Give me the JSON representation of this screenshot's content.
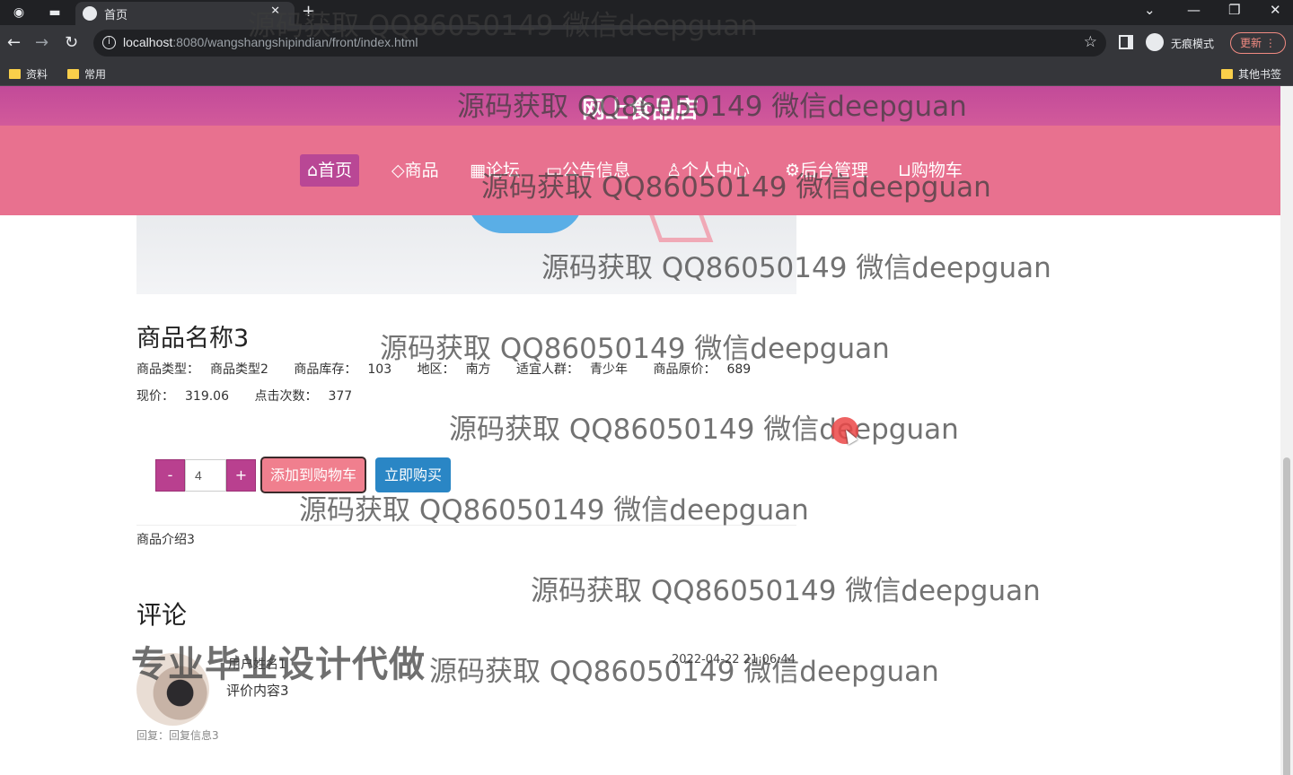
{
  "browser": {
    "tab_title": "首页",
    "url_host": "localhost",
    "url_path": ":8080/wangshangshipindian/front/index.html",
    "incognito_label": "无痕模式",
    "update_label": "更新",
    "bookmarks": [
      "资料",
      "常用"
    ],
    "other_bookmarks": "其他书签"
  },
  "site": {
    "title": "网上食品店",
    "nav": [
      {
        "icon": "⌂",
        "label": "首页"
      },
      {
        "icon": "◇",
        "label": "商品"
      },
      {
        "icon": "▦",
        "label": "论坛"
      },
      {
        "icon": "▭",
        "label": "公告信息"
      },
      {
        "icon": "♙",
        "label": "个人中心"
      },
      {
        "icon": "⚙",
        "label": "后台管理"
      },
      {
        "icon": "⊔",
        "label": "购物车"
      }
    ]
  },
  "product": {
    "name": "商品名称3",
    "type_label": "商品类型：",
    "type_value": "商品类型2",
    "stock_label": "商品库存：",
    "stock_value": "103",
    "region_label": "地区：",
    "region_value": "南方",
    "audience_label": "适宜人群：",
    "audience_value": "青少年",
    "orig_price_label": "商品原价：",
    "orig_price_value": "689",
    "price_label": "现价：",
    "price_value": "319.06",
    "clicks_label": "点击次数：",
    "clicks_value": "377",
    "quantity": "4",
    "minus": "-",
    "plus": "+",
    "add_to_cart": "添加到购物车",
    "buy_now": "立即购买",
    "intro": "商品介绍3"
  },
  "comments": {
    "title": "评论",
    "items": [
      {
        "user": "用户姓名1",
        "date": "2022-04-22 21:06:44",
        "content": "评价内容3",
        "reply": "回复：回复信息3"
      }
    ]
  },
  "overlay": {
    "watermark": "源码获取 QQ86050149 微信deepguan",
    "promo": "专业毕业设计代做"
  }
}
